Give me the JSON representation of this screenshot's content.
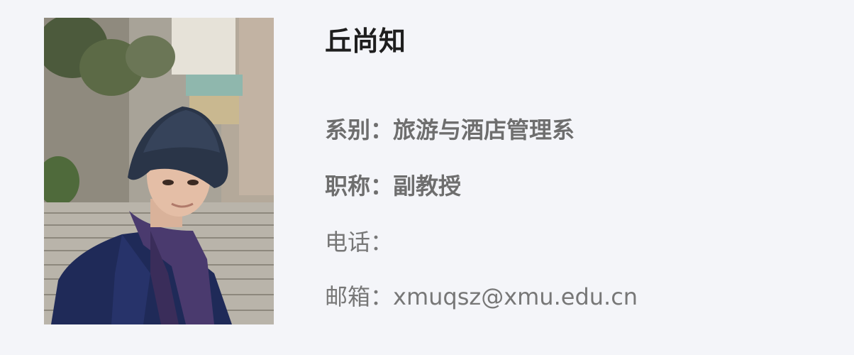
{
  "profile": {
    "name": "丘尚知",
    "department": {
      "label": "系别：",
      "value": "旅游与酒店管理系"
    },
    "title": {
      "label": "职称：",
      "value": "副教授"
    },
    "phone": {
      "label": "电话：",
      "value": ""
    },
    "email": {
      "label": "邮箱：",
      "value": "xmuqsz@xmu.edu.cn"
    }
  },
  "photo": {
    "subject": "portrait of a man in a dark bucket hat, navy coat and purple scarf on outdoor stone stairs"
  },
  "colors": {
    "background": "#f4f5f9",
    "name_text": "#1e1e1e",
    "info_text": "#777777"
  }
}
